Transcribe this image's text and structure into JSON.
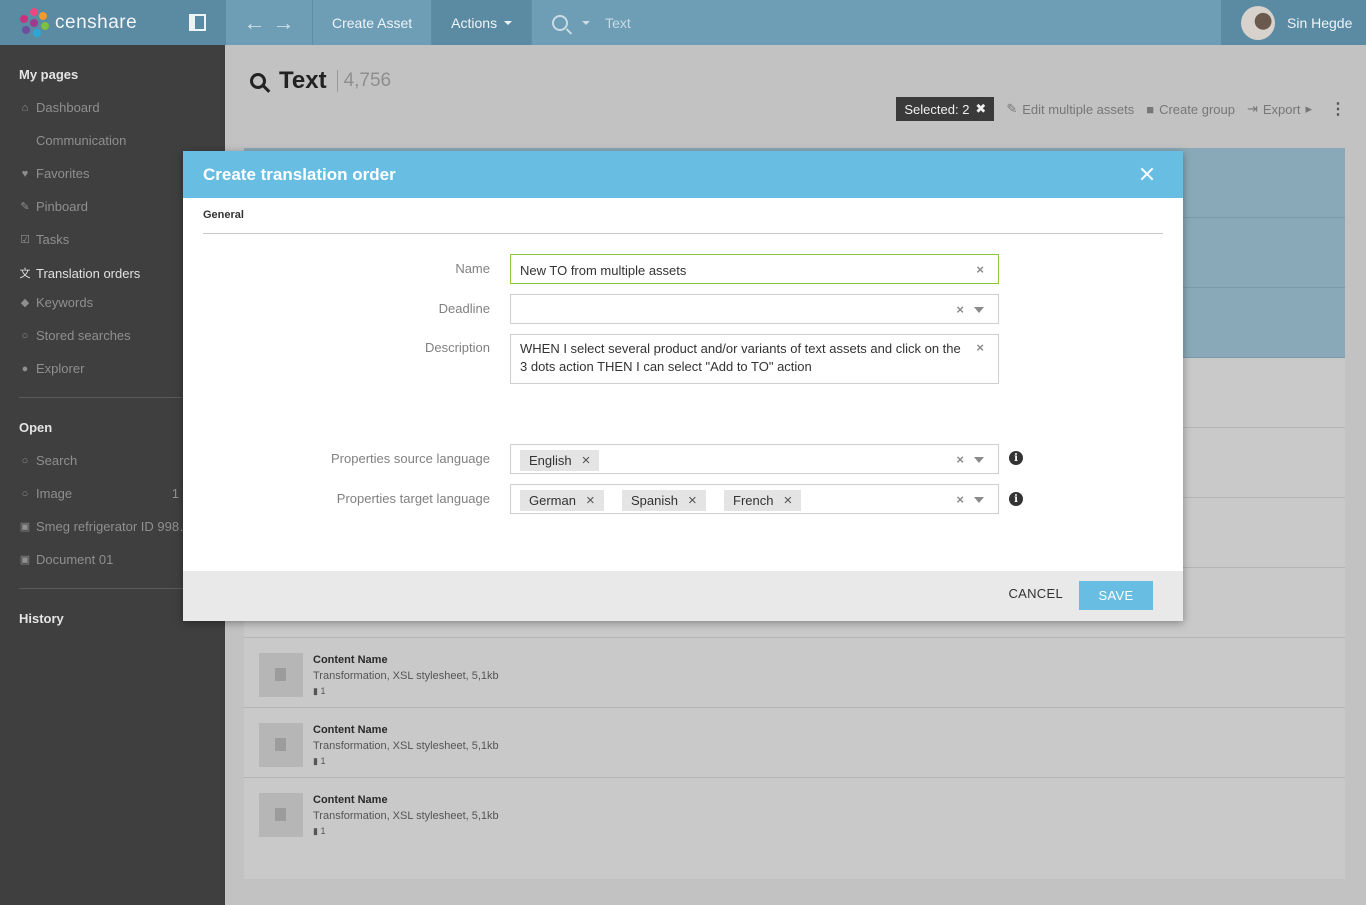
{
  "app": {
    "brand": "censhare",
    "user_name": "Sin Hegde"
  },
  "topbar": {
    "create_asset": "Create Asset",
    "actions": "Actions",
    "search_scope": "Text"
  },
  "sidebar": {
    "my_pages_title": "My pages",
    "my_pages": [
      {
        "label": "Dashboard",
        "icon": "home-icon"
      },
      {
        "label": "Communication",
        "icon": "chat-icon"
      },
      {
        "label": "Favorites",
        "icon": "heart-icon"
      },
      {
        "label": "Pinboard",
        "icon": "pin-icon"
      },
      {
        "label": "Tasks",
        "icon": "checkbox-icon"
      },
      {
        "label": "Translation orders",
        "icon": "translate-icon"
      },
      {
        "label": "Keywords",
        "icon": "tag-icon"
      },
      {
        "label": "Stored searches",
        "icon": "search-icon"
      },
      {
        "label": "Explorer",
        "icon": "compass-icon"
      }
    ],
    "open_title": "Open",
    "open": [
      {
        "label": "Search",
        "icon": "search-icon"
      },
      {
        "label": "Image",
        "icon": "search-icon",
        "count": "1"
      },
      {
        "label": "Smeg refrigerator ID 998…",
        "icon": "image-icon"
      },
      {
        "label": "Document 01",
        "icon": "image-icon"
      }
    ],
    "history_title": "History"
  },
  "main": {
    "title": "Text",
    "count": "4,756",
    "selected": "Selected: 2",
    "edit_multiple": "Edit multiple assets",
    "create_group": "Create group",
    "export": "Export",
    "rows": [
      {
        "name": "Content Name",
        "meta": "Transformation, XSL stylesheet, 5,1kb",
        "versions": "1"
      },
      {
        "name": "Content Name",
        "meta": "Transformation, XSL stylesheet, 5,1kb",
        "versions": "1"
      },
      {
        "name": "Content Name",
        "meta": "Transformation, XSL stylesheet, 5,1kb",
        "versions": "1"
      }
    ]
  },
  "modal": {
    "title": "Create translation order",
    "tab": "General",
    "name_label": "Name",
    "name_value": "New TO from multiple assets",
    "deadline_label": "Deadline",
    "deadline_value": "",
    "description_label": "Description",
    "description_value": "WHEN I select several product and/or variants of text assets and click on the 3 dots action THEN I can select \"Add to TO\" action",
    "source_label": "Properties source language",
    "source_tags": [
      "English"
    ],
    "target_label": "Properties target language",
    "target_tags": [
      "German",
      "Spanish",
      "French"
    ],
    "cancel": "CANCEL",
    "save": "SAVE"
  },
  "colors": {
    "header": "#68bde3",
    "topbar": "#6e9db6",
    "sidebar": "#3f3f3f",
    "focus_border": "#8cc63f"
  }
}
